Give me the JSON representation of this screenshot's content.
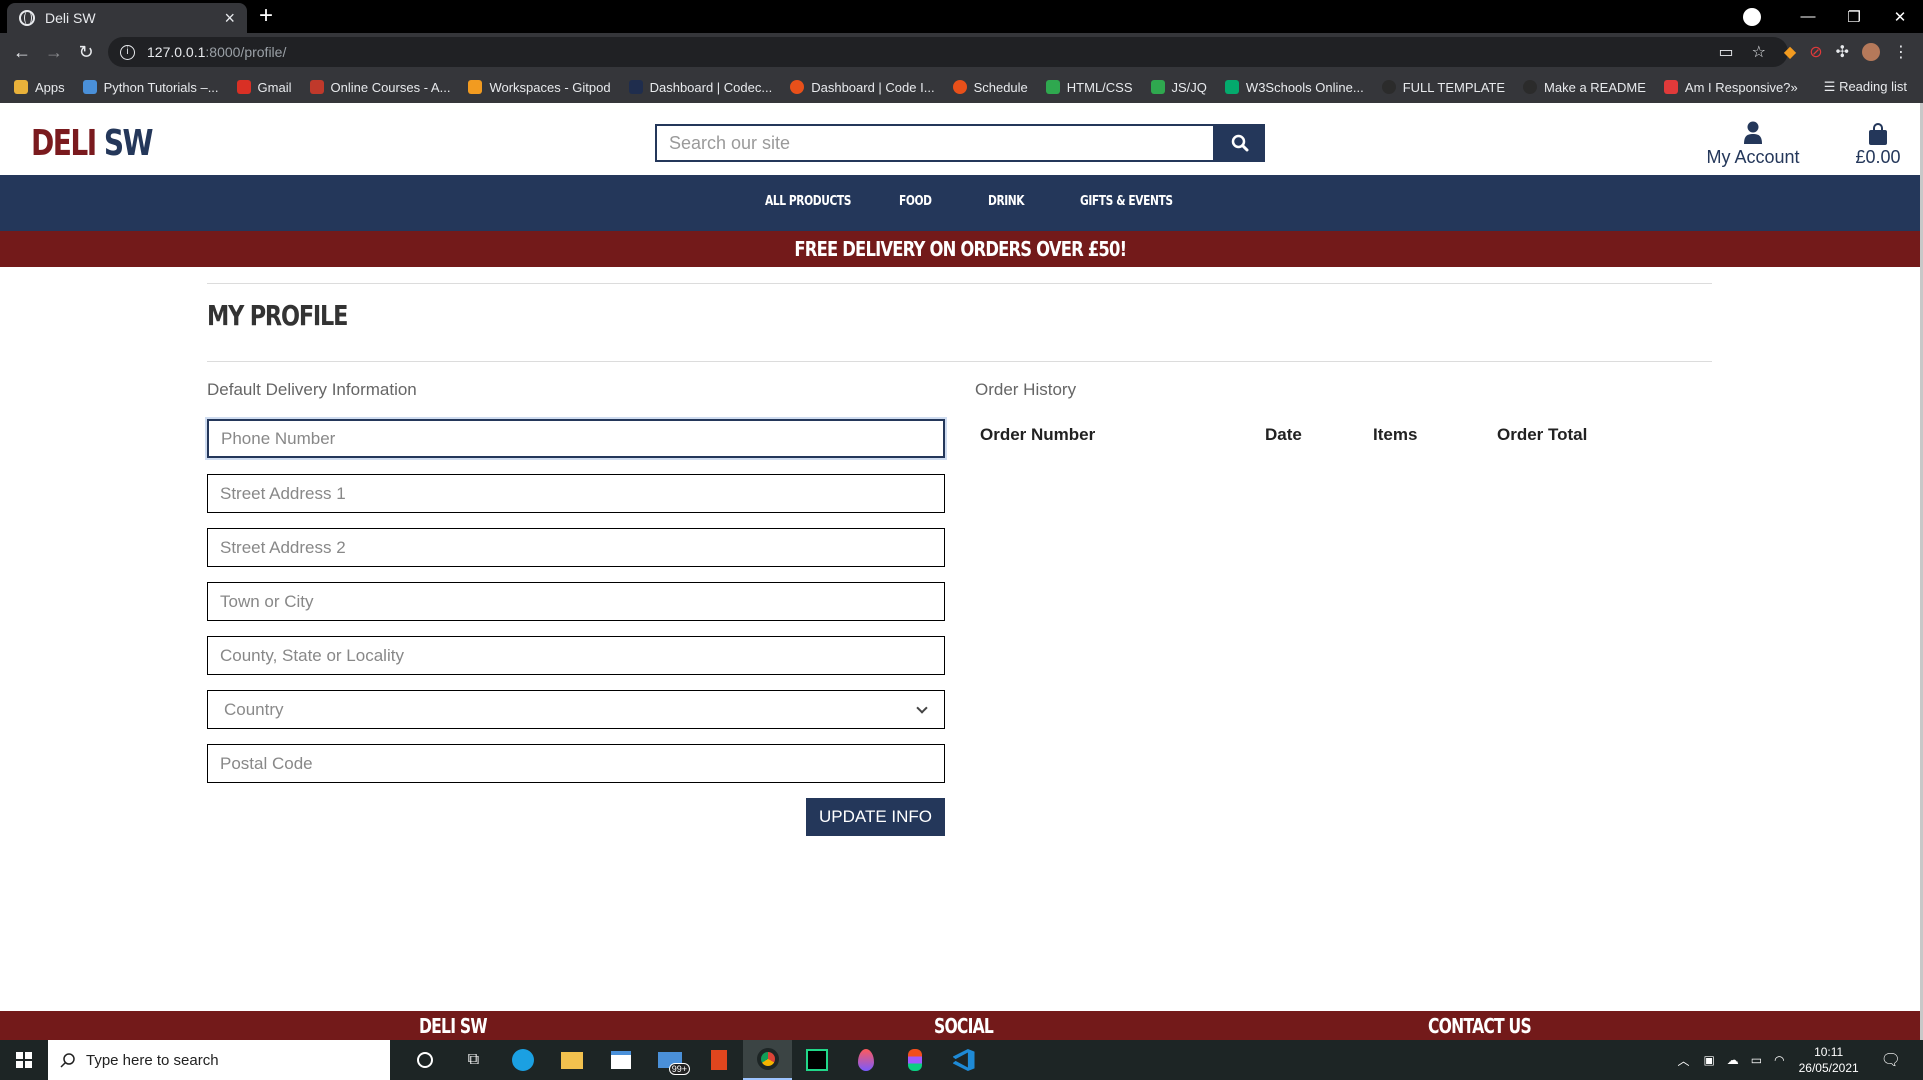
{
  "browser": {
    "tab_title": "Deli SW",
    "url_host": "127.0.0.1",
    "url_path": ":8000/profile/",
    "bookmarks": [
      {
        "label": "Apps",
        "color": "#e8b13a"
      },
      {
        "label": "Python Tutorials –...",
        "color": "#4a90d9"
      },
      {
        "label": "Gmail",
        "color": "#d93025"
      },
      {
        "label": "Online Courses - A...",
        "color": "#c0392b"
      },
      {
        "label": "Workspaces - Gitpod",
        "color": "#f29b20"
      },
      {
        "label": "Dashboard | Codec...",
        "color": "#1f2d4d"
      },
      {
        "label": "Dashboard | Code I...",
        "color": "#e8501a"
      },
      {
        "label": "Schedule",
        "color": "#e8501a"
      },
      {
        "label": "HTML/CSS",
        "color": "#2fa84f"
      },
      {
        "label": "JS/JQ",
        "color": "#2fa84f"
      },
      {
        "label": "W3Schools Online...",
        "color": "#04aa6d"
      },
      {
        "label": "FULL TEMPLATE",
        "color": "#2b2b2b"
      },
      {
        "label": "Make a README",
        "color": "#2b2b2b"
      },
      {
        "label": "Am I Responsive?",
        "color": "#e03a3a"
      }
    ],
    "reading_list": "Reading list"
  },
  "site": {
    "logo_part1": "DELI",
    "logo_part2": "SW",
    "search_placeholder": "Search our site",
    "account_label": "My Account",
    "bag_total": "£0.00",
    "nav": [
      "ALL PRODUCTS",
      "FOOD",
      "DRINK",
      "GIFTS & EVENTS"
    ],
    "banner": "FREE DELIVERY ON ORDERS OVER £50!"
  },
  "profile": {
    "title": "MY PROFILE",
    "delivery_heading": "Default Delivery Information",
    "fields": {
      "phone": "Phone Number",
      "street1": "Street Address 1",
      "street2": "Street Address 2",
      "town": "Town or City",
      "county": "County, State or Locality",
      "country": "Country",
      "postcode": "Postal Code"
    },
    "update_button": "UPDATE INFO",
    "order_history_heading": "Order History",
    "order_columns": [
      "Order Number",
      "Date",
      "Items",
      "Order Total"
    ]
  },
  "footer": {
    "col1": "DELI SW",
    "col2": "SOCIAL",
    "col3": "CONTACT US"
  },
  "taskbar": {
    "search_placeholder": "Type here to search",
    "time": "10:11",
    "date": "26/05/2021",
    "mail_badge": "99+"
  },
  "colors": {
    "navy": "#24375a",
    "maroon": "#731a1a"
  }
}
